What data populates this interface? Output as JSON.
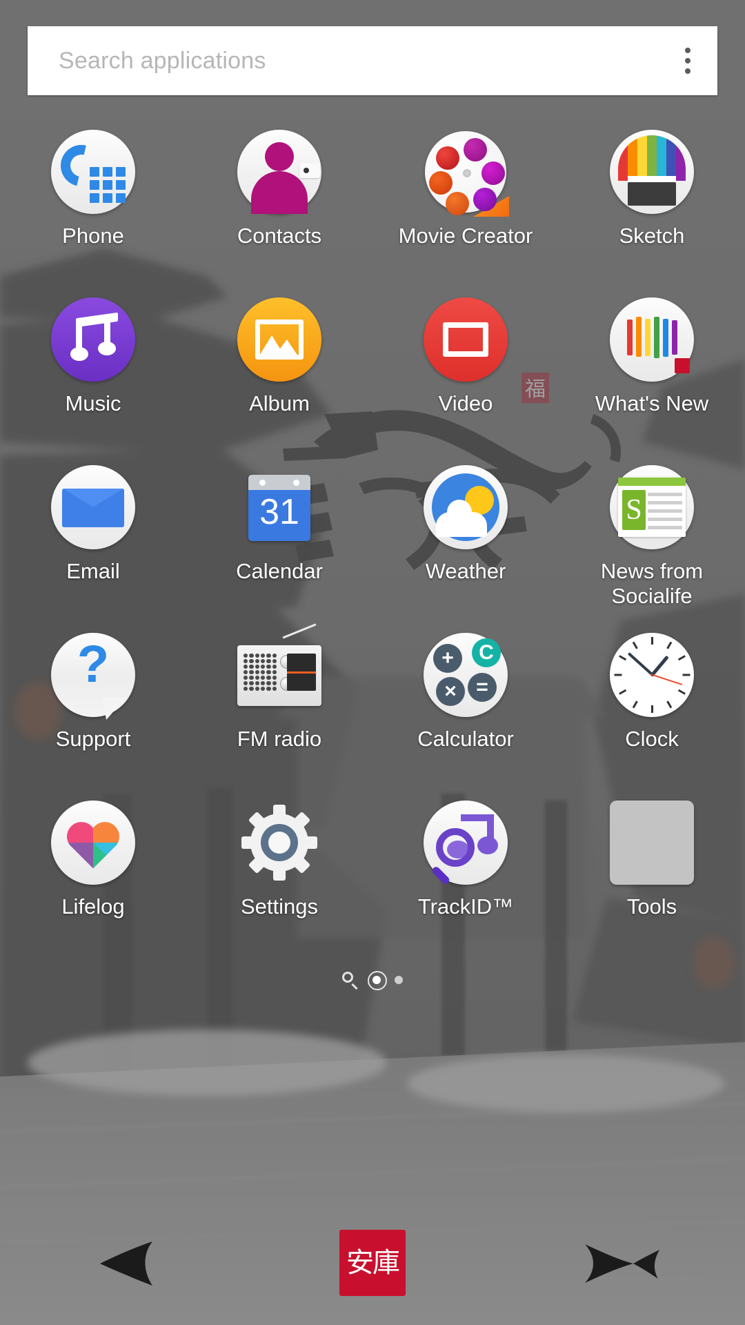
{
  "search": {
    "placeholder": "Search applications",
    "overflow_icon": "overflow-menu-icon"
  },
  "apps": [
    {
      "label": "Phone",
      "icon": "phone-icon"
    },
    {
      "label": "Contacts",
      "icon": "contacts-icon"
    },
    {
      "label": "Movie Creator",
      "icon": "movie-creator-icon"
    },
    {
      "label": "Sketch",
      "icon": "sketch-icon"
    },
    {
      "label": "Music",
      "icon": "music-icon"
    },
    {
      "label": "Album",
      "icon": "album-icon"
    },
    {
      "label": "Video",
      "icon": "video-icon"
    },
    {
      "label": "What's New",
      "icon": "whats-new-icon"
    },
    {
      "label": "Email",
      "icon": "email-icon"
    },
    {
      "label": "Calendar",
      "icon": "calendar-icon"
    },
    {
      "label": "Weather",
      "icon": "weather-icon"
    },
    {
      "label": "News from Socialife",
      "icon": "news-socialife-icon"
    },
    {
      "label": "Support",
      "icon": "support-icon"
    },
    {
      "label": "FM radio",
      "icon": "fm-radio-icon"
    },
    {
      "label": "Calculator",
      "icon": "calculator-icon"
    },
    {
      "label": "Clock",
      "icon": "clock-icon"
    },
    {
      "label": "Lifelog",
      "icon": "lifelog-icon"
    },
    {
      "label": "Settings",
      "icon": "settings-icon"
    },
    {
      "label": "TrackID™",
      "icon": "trackid-icon"
    },
    {
      "label": "Tools",
      "icon": "tools-folder-icon"
    }
  ],
  "calendar": {
    "day": "31"
  },
  "news": {
    "letter": "S"
  },
  "calculator": {
    "plus": "+",
    "clear": "C",
    "times": "×",
    "equals": "="
  },
  "pager": {
    "search_icon": "search-page-icon",
    "dots": [
      {
        "state": "active"
      },
      {
        "state": "inactive"
      }
    ]
  },
  "navbar": {
    "back_icon": "back-arrow-icon",
    "home_icon": "home-seal-icon",
    "home_seal_text": "安庫",
    "recents_icon": "recents-arrow-icon"
  },
  "colors": {
    "phone_blue": "#2e8ae6",
    "contacts_magenta": "#b0117a",
    "music_purple": "#7b3fd4",
    "album_amber": "#fbb516",
    "video_red": "#ea3b35",
    "email_blue": "#3f7fe8",
    "calendar_blue": "#3a79e0",
    "weather_blue": "#3b84e0",
    "weather_sun": "#ffc719",
    "news_green": "#8cc63e",
    "support_blue": "#2e8ae6",
    "calc_teal": "#14b3a6",
    "calc_slate": "#4a5c6b",
    "settings_slate": "#5b728a",
    "trackid_purple": "#6a42c8",
    "tools_grey": "#c3c3c3",
    "seal_red": "#c8102e",
    "backdrop": "#6a6a6a"
  }
}
